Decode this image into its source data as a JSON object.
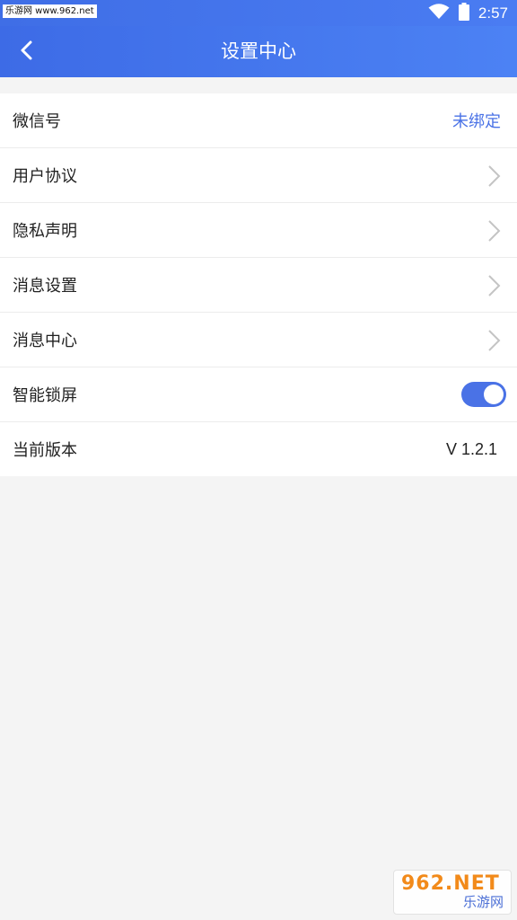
{
  "status_bar": {
    "watermark_text": "乐游网 www.962.net",
    "wifi_icon": "wifi-icon",
    "battery_icon": "battery-icon",
    "time": "2:57"
  },
  "nav": {
    "back_icon": "chevron-left-icon",
    "title": "设置中心"
  },
  "settings": {
    "rows": [
      {
        "label": "微信号",
        "value": "未绑定",
        "value_color": "#4a72e6"
      },
      {
        "label": "用户协议",
        "accessory": "chevron-right-icon"
      },
      {
        "label": "隐私声明",
        "accessory": "chevron-right-icon"
      },
      {
        "label": "消息设置",
        "accessory": "chevron-right-icon"
      },
      {
        "label": "消息中心",
        "accessory": "chevron-right-icon"
      },
      {
        "label": "智能锁屏",
        "toggle_on": true
      },
      {
        "label": "当前版本",
        "value": "V 1.2.1"
      }
    ]
  },
  "watermark": {
    "top": "962.NET",
    "bottom": "乐游网"
  },
  "colors": {
    "accent": "#4a72e6",
    "header_start": "#3d6be6",
    "header_end": "#4c82f4",
    "background": "#f4f4f4"
  }
}
